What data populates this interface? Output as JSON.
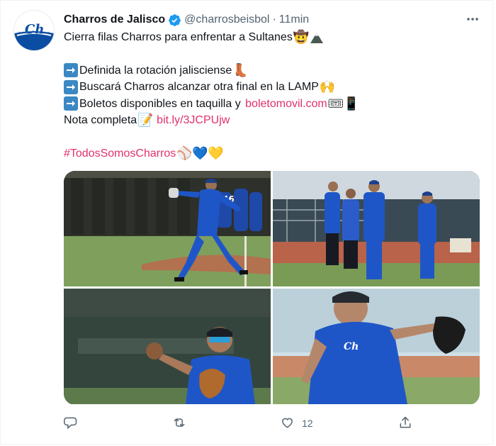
{
  "tweet": {
    "author_name": "Charros de Jalisco",
    "handle": "@charrosbeisbol",
    "separator": "·",
    "time": "11min",
    "lines": {
      "l1": "Cierra filas Charros para enfrentar a Sultanes",
      "l2": "Definida la rotación jalisciense",
      "l3": "Buscará Charros alcanzar otra final en la LAMP",
      "l4a": "Boletos disponibles en taquilla y ",
      "l4_link": "boletomovil.com",
      "l5": "Nota completa",
      "l5_link": "bit.ly/3JCPUjw",
      "hashtag": "#TodosSomosCharros"
    },
    "emoji": {
      "cowboy": "🤠",
      "mountain": "⛰",
      "boot": "👢",
      "raised_hands": "🙌",
      "ticket": "🎟",
      "phone": "📱",
      "memo": "📝",
      "baseball": "⚾",
      "blue_heart": "💙",
      "yellow_heart": "💛"
    },
    "avatar_logo_text": "Ch",
    "photos": {
      "p1_jersey_number": "46"
    },
    "actions": {
      "likes_count": "12"
    },
    "colors": {
      "link": "#e1306c",
      "verified": "#1d9bf0",
      "secondary_text": "#536471"
    }
  }
}
